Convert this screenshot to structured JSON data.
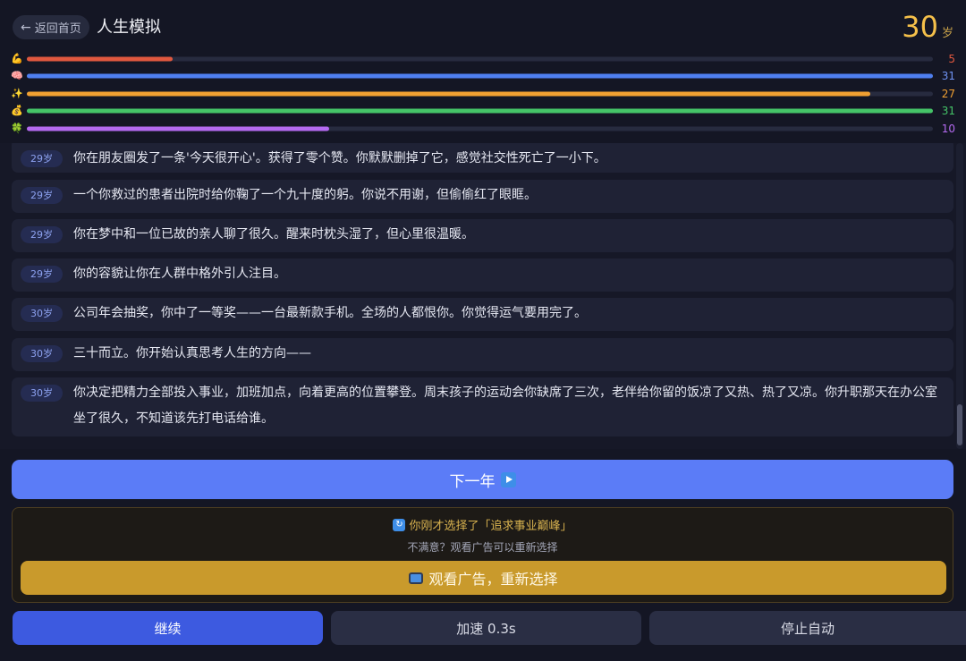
{
  "header": {
    "back_label": "返回首页",
    "back_arrow": "←",
    "title": "人生模拟",
    "age_value": "30",
    "age_unit": "岁"
  },
  "stats": [
    {
      "icon": "💪",
      "value": 5,
      "max": 31,
      "color": "#e0583f",
      "label_color": "#e0583f"
    },
    {
      "icon": "🧠",
      "value": 31,
      "max": 31,
      "color": "#4f7ff0",
      "label_color": "#6f93f2"
    },
    {
      "icon": "✨",
      "value": 27,
      "max": 29.0,
      "color": "#f0a032",
      "label_color": "#f0a032"
    },
    {
      "icon": "💰",
      "value": 31,
      "max": 31,
      "color": "#45c468",
      "label_color": "#45c468"
    },
    {
      "icon": "🍀",
      "value": 10,
      "max": 30.0,
      "color": "#b46af0",
      "label_color": "#b46af0"
    }
  ],
  "log": [
    {
      "age": "29岁",
      "text": "你在朋友圈发了一条'今天很开心'。获得了零个赞。你默默删掉了它，感觉社交性死亡了一小下。"
    },
    {
      "age": "29岁",
      "text": "一个你救过的患者出院时给你鞠了一个九十度的躬。你说不用谢，但偷偷红了眼眶。"
    },
    {
      "age": "29岁",
      "text": "你在梦中和一位已故的亲人聊了很久。醒来时枕头湿了，但心里很温暖。"
    },
    {
      "age": "29岁",
      "text": "你的容貌让你在人群中格外引人注目。"
    },
    {
      "age": "30岁",
      "text": "公司年会抽奖，你中了一等奖——一台最新款手机。全场的人都恨你。你觉得运气要用完了。"
    },
    {
      "age": "30岁",
      "text": "三十而立。你开始认真思考人生的方向——"
    },
    {
      "age": "30岁",
      "text": "你决定把精力全部投入事业，加班加点，向着更高的位置攀登。周末孩子的运动会你缺席了三次，老伴给你留的饭凉了又热、热了又凉。你升职那天在办公室坐了很久，不知道该先打电话给谁。"
    }
  ],
  "next_button": {
    "label": "下一年"
  },
  "ad_panel": {
    "chosen_text": "你刚才选择了「追求事业巅峰」",
    "hint_text": "不满意？观看广告可以重新选择",
    "button_label": "观看广告，重新选择"
  },
  "controls": {
    "continue_label": "继续",
    "speed_label": "加速 0.3s",
    "stop_label": "停止自动"
  }
}
